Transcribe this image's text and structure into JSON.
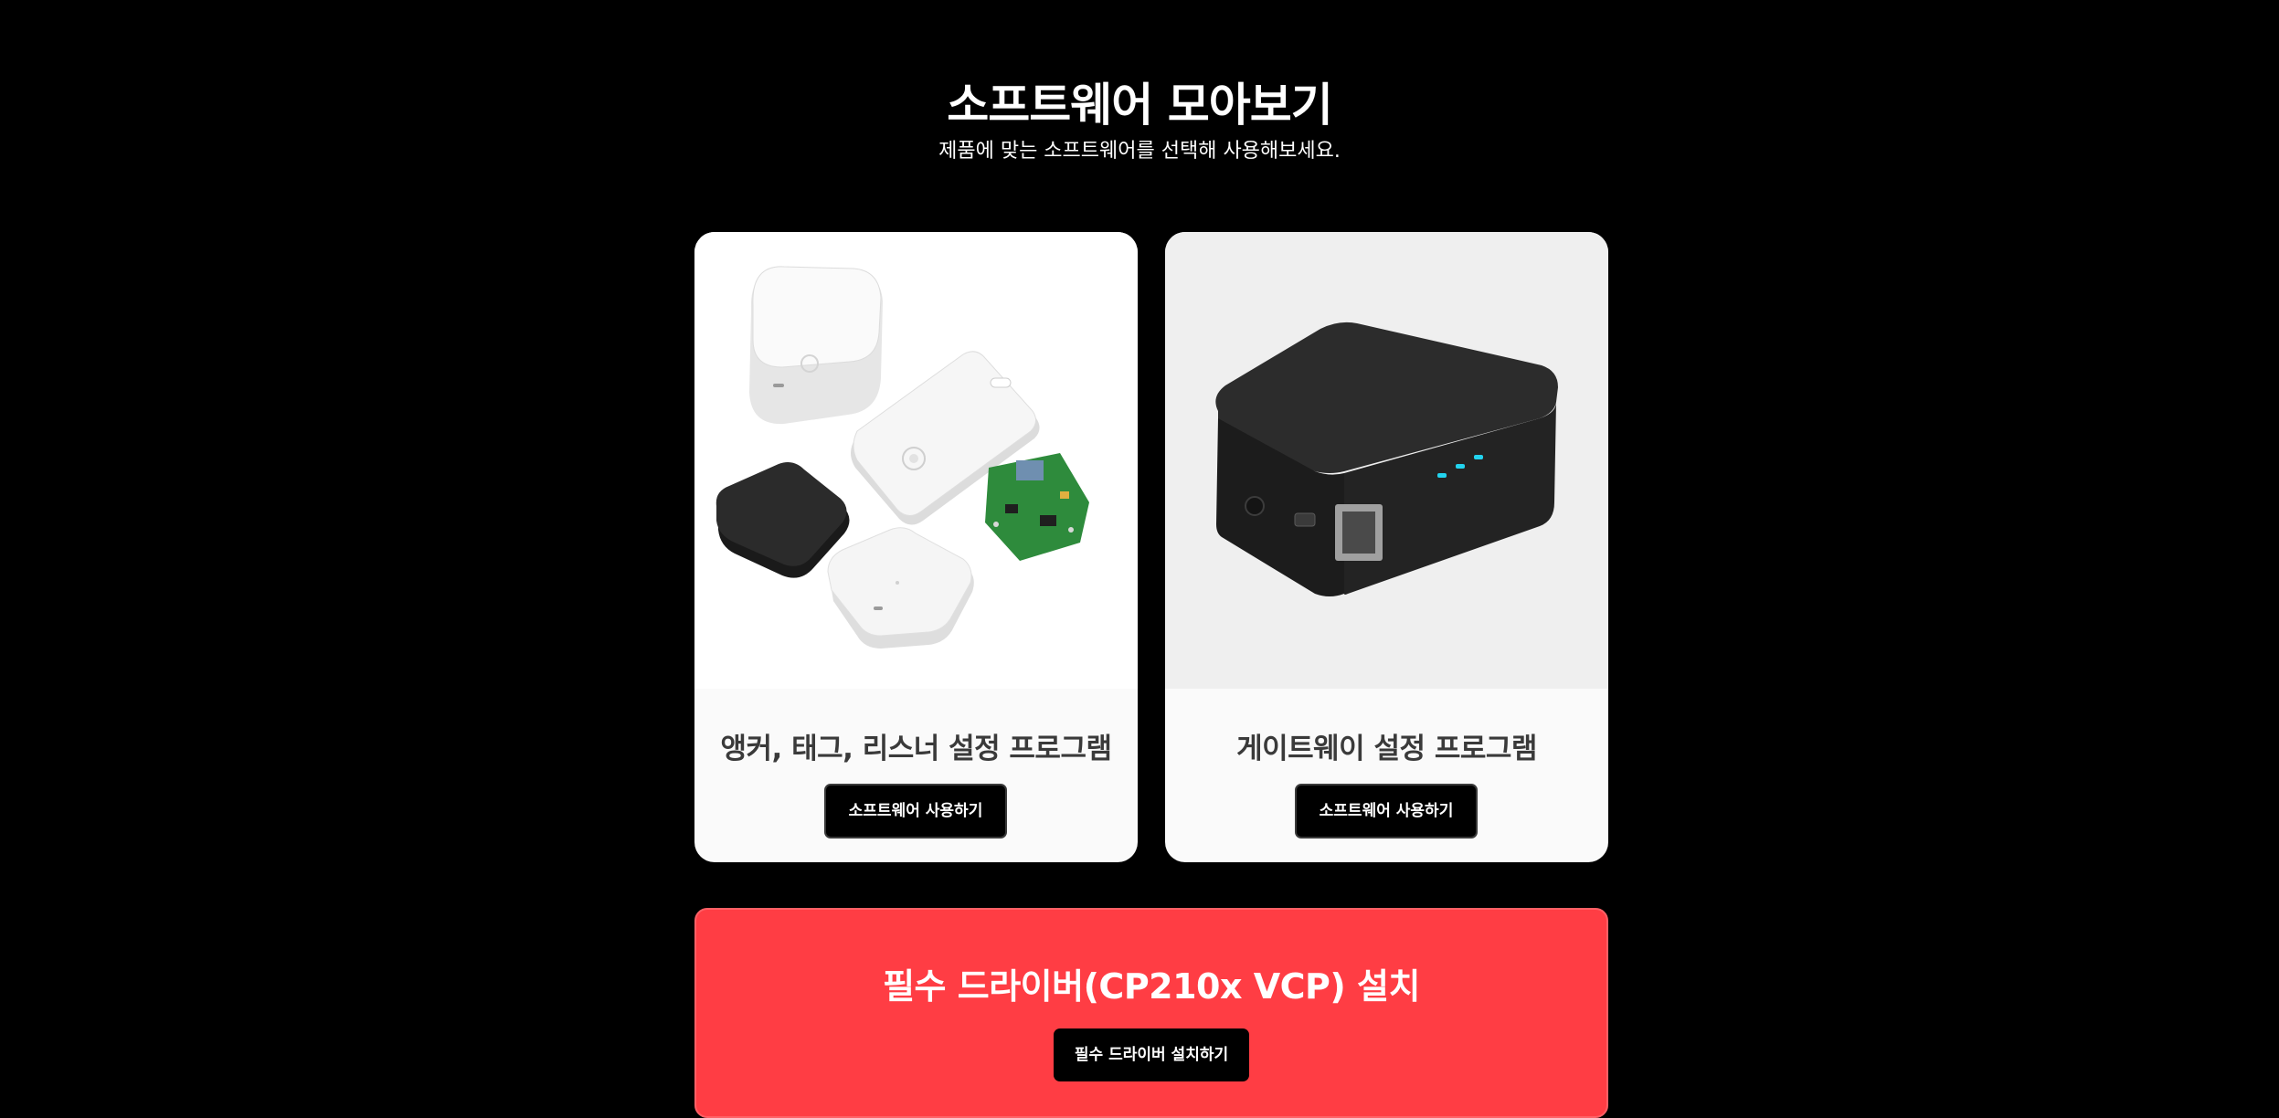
{
  "header": {
    "title": "소프트웨어 모아보기",
    "subtitle": "제품에 맞는 소프트웨어를 선택해 사용해보세요."
  },
  "cards": [
    {
      "title": "앵커, 태그, 리스너 설정 프로그램",
      "button_label": "소프트웨어 사용하기",
      "image": "anchor-tag-listener-devices-image"
    },
    {
      "title": "게이트웨이 설정 프로그램",
      "button_label": "소프트웨어 사용하기",
      "image": "gateway-device-image"
    }
  ],
  "driver": {
    "title": "필수 드라이버(CP210x VCP) 설치",
    "button_label": "필수 드라이버 설치하기"
  },
  "colors": {
    "background": "#000000",
    "card_background": "#fafafa",
    "driver_panel": "#ff3d44",
    "button": "#000000"
  }
}
